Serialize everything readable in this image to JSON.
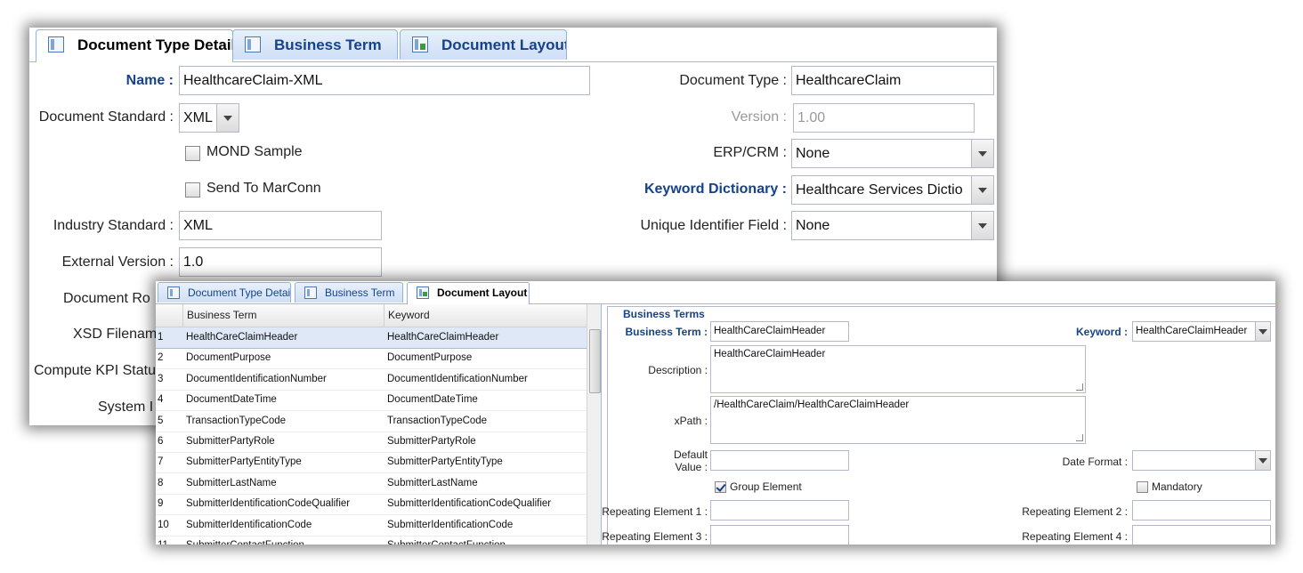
{
  "back": {
    "tabs": [
      {
        "label": "Document Type Detail",
        "icon": "table-icon",
        "active": true
      },
      {
        "label": "Business Term",
        "icon": "list-icon",
        "active": false
      },
      {
        "label": "Document Layout",
        "icon": "layout-icon",
        "active": false
      }
    ],
    "left": {
      "name_label": "Name :",
      "name_value": "HealthcareClaim-XML",
      "doc_standard_label": "Document Standard :",
      "doc_standard_value": "XML",
      "mond_sample_label": "MOND Sample",
      "send_marconn_label": "Send To MarConn",
      "industry_standard_label": "Industry Standard :",
      "industry_standard_value": "XML",
      "external_version_label": "External Version :",
      "external_version_value": "1.0",
      "document_root_label": "Document Ro",
      "xsd_filename_label": "XSD Filenam",
      "compute_kpi_label": "Compute KPI Statu",
      "system_label": "System I"
    },
    "right": {
      "document_type_label": "Document Type :",
      "document_type_value": "HealthcareClaim",
      "version_label": "Version :",
      "version_value": "1.00",
      "erp_crm_label": "ERP/CRM :",
      "erp_crm_value": "None",
      "keyword_dictionary_label": "Keyword Dictionary :",
      "keyword_dictionary_value": "Healthcare Services Dictio",
      "unique_identifier_label": "Unique Identifier Field :",
      "unique_identifier_value": "None"
    }
  },
  "front": {
    "tabs": [
      {
        "label": "Document Type Detail",
        "icon": "table-icon",
        "active": false
      },
      {
        "label": "Business Term",
        "icon": "list-icon",
        "active": false
      },
      {
        "label": "Document Layout",
        "icon": "layout-icon",
        "active": true
      }
    ],
    "grid": {
      "columns": [
        "Business Term",
        "Keyword"
      ],
      "rows": [
        {
          "num": "1",
          "term": "HealthCareClaimHeader",
          "keyword": "HealthCareClaimHeader",
          "selected": true
        },
        {
          "num": "2",
          "term": "DocumentPurpose",
          "keyword": "DocumentPurpose"
        },
        {
          "num": "3",
          "term": "DocumentIdentificationNumber",
          "keyword": "DocumentIdentificationNumber"
        },
        {
          "num": "4",
          "term": "DocumentDateTime",
          "keyword": "DocumentDateTime"
        },
        {
          "num": "5",
          "term": "TransactionTypeCode",
          "keyword": "TransactionTypeCode"
        },
        {
          "num": "6",
          "term": "SubmitterPartyRole",
          "keyword": "SubmitterPartyRole"
        },
        {
          "num": "7",
          "term": "SubmitterPartyEntityType",
          "keyword": "SubmitterPartyEntityType"
        },
        {
          "num": "8",
          "term": "SubmitterLastName",
          "keyword": "SubmitterLastName"
        },
        {
          "num": "9",
          "term": "SubmitterIdentificationCodeQualifier",
          "keyword": "SubmitterIdentificationCodeQualifier"
        },
        {
          "num": "10",
          "term": "SubmitterIdentificationCode",
          "keyword": "SubmitterIdentificationCode"
        },
        {
          "num": "11",
          "term": "SubmitterContactFunction",
          "keyword": "SubmitterContactFunction"
        }
      ]
    },
    "form": {
      "legend": "Business Terms",
      "business_term_label": "Business Term :",
      "business_term_value": "HealthCareClaimHeader",
      "keyword_label": "Keyword :",
      "keyword_value": "HealthCareClaimHeader",
      "description_label": "Description :",
      "description_value": "HealthCareClaimHeader",
      "xpath_label": "xPath :",
      "xpath_value": "/HealthCareClaim/HealthCareClaimHeader",
      "default_value_label_1": "Default",
      "default_value_label_2": "Value :",
      "default_value_value": "",
      "date_format_label": "Date Format :",
      "date_format_value": "",
      "group_element_label": "Group Element",
      "group_element_checked": true,
      "mandatory_label": "Mandatory",
      "mandatory_checked": false,
      "repeating_1_label": "Repeating Element 1 :",
      "repeating_2_label": "Repeating Element 2 :",
      "repeating_3_label": "Repeating Element 3 :",
      "repeating_4_label": "Repeating Element 4 :"
    }
  }
}
